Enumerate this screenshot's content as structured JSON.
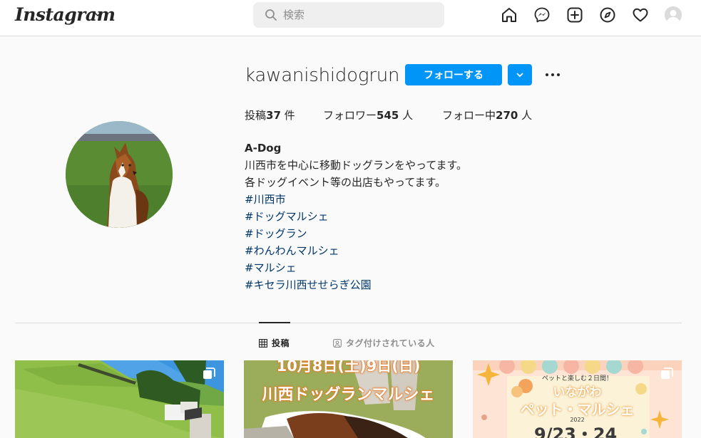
{
  "nav": {
    "logo": "Instagram",
    "search_placeholder": "検索"
  },
  "profile": {
    "username": "kawanishidogrun",
    "follow_label": "フォローする",
    "stats": {
      "posts_label": "投稿",
      "posts_count": "37",
      "posts_unit": " 件",
      "followers_label": "フォロワー",
      "followers_count": "545",
      "followers_unit": " 人",
      "following_label": "フォロー中",
      "following_count": "270",
      "following_unit": " 人"
    },
    "bio": {
      "name": "A-Dog",
      "lines": [
        "川西市を中心に移動ドッグランをやってます。",
        "各ドッグイベント等の出店もやってます。"
      ],
      "hashtags": [
        "#川西市",
        "#ドッグマルシェ",
        "#ドッグラン",
        "#わんわんマルシェ",
        "#マルシェ",
        "#キセラ川西せせらぎ公園"
      ]
    }
  },
  "tabs": [
    {
      "label": "投稿",
      "icon": "grid-icon",
      "active": true
    },
    {
      "label": "タグ付けされている人",
      "icon": "tag-person-icon",
      "active": false
    }
  ],
  "posts": [
    {
      "kind": "photo",
      "multi": true
    },
    {
      "kind": "event",
      "multi": false,
      "title_line1": "10月8日(土)9日(日)",
      "title_line2": "川西ドッグランマルシェ"
    },
    {
      "kind": "event",
      "multi": true,
      "small": "ペットと楽しむ２日間！",
      "title_line1": "いながわ",
      "title_line2": "ペット・マルシェ",
      "year": "2022",
      "date": "9/23・24"
    }
  ],
  "colors": {
    "accent": "#0095f6",
    "link": "#00376b",
    "text": "#262626",
    "muted": "#8e8e8e",
    "border": "#dbdbdb",
    "background": "#fafafa"
  }
}
